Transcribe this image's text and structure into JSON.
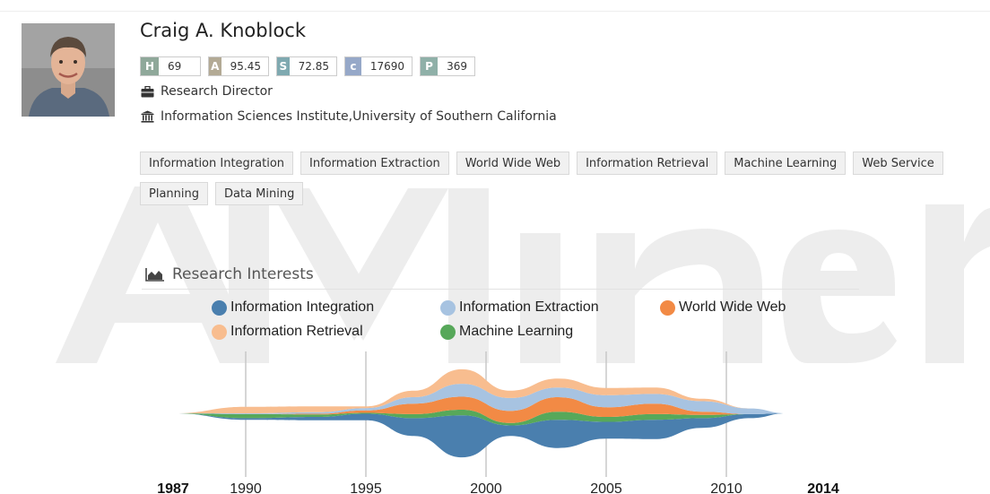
{
  "watermark": {
    "text": "AMiner"
  },
  "profile": {
    "name": "Craig A. Knoblock",
    "metrics": [
      {
        "key": "H",
        "value": "69",
        "color": "#8fa89a"
      },
      {
        "key": "A",
        "value": "95.45",
        "color": "#b3aa95"
      },
      {
        "key": "S",
        "value": "72.85",
        "color": "#7fa9b0"
      },
      {
        "key": "c",
        "value": "17690",
        "color": "#96a8c8"
      },
      {
        "key": "P",
        "value": "369",
        "color": "#8fb0a8"
      }
    ],
    "position": {
      "icon": "briefcase-icon",
      "text": "Research Director"
    },
    "affiliation": {
      "icon": "institution-icon",
      "text": "Information Sciences Institute,University of Southern California"
    }
  },
  "tags": [
    "Information Integration",
    "Information Extraction",
    "World Wide Web",
    "Information Retrieval",
    "Machine Learning",
    "Web Service",
    "Planning",
    "Data Mining"
  ],
  "research_interests": {
    "title": "Research Interests",
    "icon": "area-chart-icon"
  },
  "chart_data": {
    "type": "area",
    "x": [
      1987,
      1990,
      1993,
      1995,
      1997,
      1999,
      2001,
      2003,
      2005,
      2007,
      2009,
      2011,
      2012.5
    ],
    "x_range": [
      1987,
      2014
    ],
    "x_ticks": [
      1990,
      1995,
      2000,
      2005,
      2010
    ],
    "x_end_labels": [
      "1987",
      "2014"
    ],
    "grid": "vertical lines at ticks",
    "legend_position": "top",
    "series": [
      {
        "name": "Information Integration",
        "color": "#4a7fae",
        "values": [
          0,
          0.2,
          0.4,
          0.8,
          2.2,
          5.2,
          1.3,
          3.5,
          2.1,
          2.4,
          1.2,
          0.5,
          0
        ]
      },
      {
        "name": "Information Extraction",
        "color": "#a7c3e1",
        "values": [
          0,
          0.1,
          0.2,
          0.3,
          0.8,
          1.6,
          1.6,
          1.2,
          1.5,
          1.2,
          1.3,
          0.7,
          0
        ]
      },
      {
        "name": "World Wide Web",
        "color": "#f28a45",
        "values": [
          0,
          0,
          0.1,
          0.3,
          1.3,
          1.6,
          1.5,
          1.8,
          1.2,
          1.3,
          0.4,
          0,
          0
        ]
      },
      {
        "name": "Information Retrieval",
        "color": "#f8bd8f",
        "values": [
          0,
          0.8,
          0.7,
          0.2,
          0.8,
          1.8,
          0.9,
          1.1,
          0.9,
          0.8,
          0.3,
          0,
          0
        ]
      },
      {
        "name": "Machine Learning",
        "color": "#57a85a",
        "values": [
          0,
          0.5,
          0.3,
          0.1,
          0.5,
          0.7,
          0.3,
          1.0,
          0.6,
          0.7,
          0.4,
          0,
          0
        ]
      }
    ]
  }
}
